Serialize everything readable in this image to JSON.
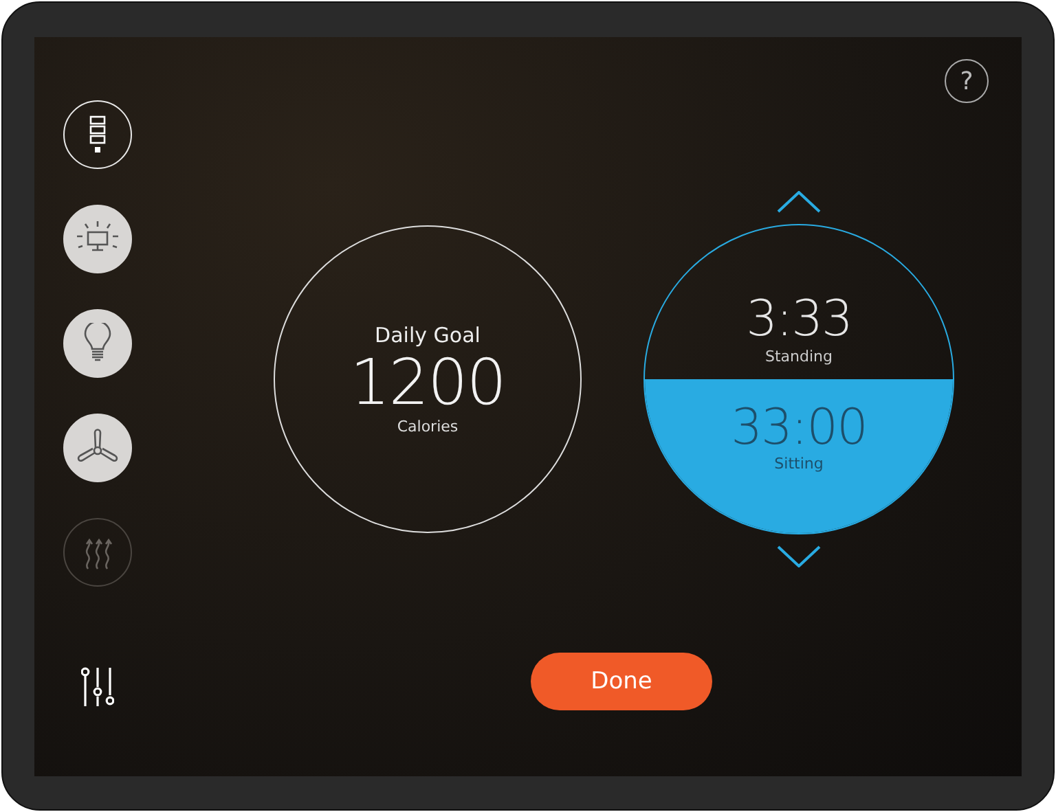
{
  "sidebar": {
    "items": [
      {
        "kind": "desk",
        "selected": true,
        "on": true
      },
      {
        "kind": "display",
        "selected": false,
        "on": true
      },
      {
        "kind": "light",
        "selected": false,
        "on": true
      },
      {
        "kind": "fan",
        "selected": false,
        "on": true
      },
      {
        "kind": "heat",
        "selected": false,
        "on": false
      }
    ]
  },
  "help": {
    "label": "?"
  },
  "goal": {
    "title": "Daily Goal",
    "value": "1200",
    "unit": "Calories"
  },
  "split": {
    "top": {
      "value": "3:33",
      "label": "Standing"
    },
    "bottom": {
      "value": "33:00",
      "label": "Sitting"
    }
  },
  "done_button": {
    "label": "Done"
  }
}
